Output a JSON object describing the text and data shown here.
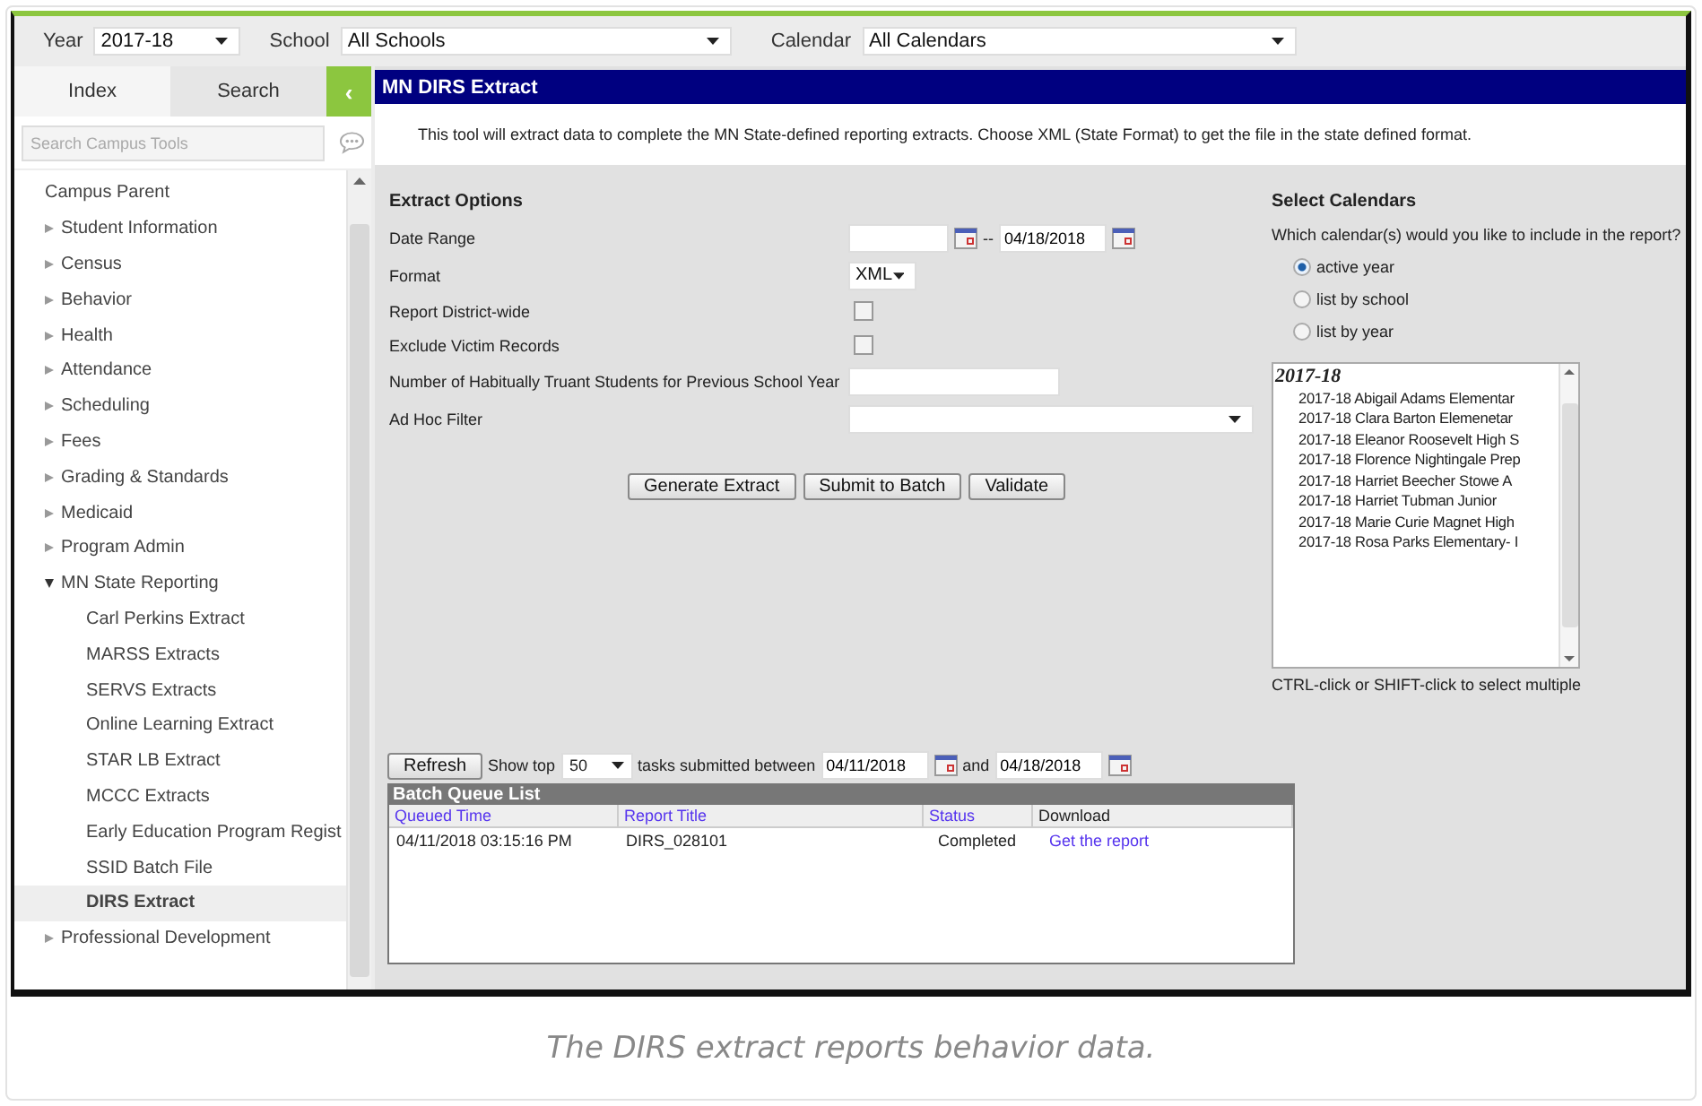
{
  "top_bar": {
    "year": {
      "label": "Year",
      "value": "2017-18"
    },
    "school": {
      "label": "School",
      "value": "All Schools"
    },
    "calendar": {
      "label": "Calendar",
      "value": "All Calendars"
    }
  },
  "sidebar": {
    "tabs": [
      {
        "label": "Index",
        "selected": true
      },
      {
        "label": "Search",
        "selected": false
      }
    ],
    "collapse_button": "‹",
    "search": {
      "placeholder": "Search Campus Tools"
    },
    "items": [
      {
        "label": "Campus Parent",
        "kind": "link"
      },
      {
        "label": "Student Information",
        "kind": "folder",
        "expanded": false
      },
      {
        "label": "Census",
        "kind": "folder",
        "expanded": false
      },
      {
        "label": "Behavior",
        "kind": "folder",
        "expanded": false
      },
      {
        "label": "Health",
        "kind": "folder",
        "expanded": false
      },
      {
        "label": "Attendance",
        "kind": "folder",
        "expanded": false
      },
      {
        "label": "Scheduling",
        "kind": "folder",
        "expanded": false
      },
      {
        "label": "Fees",
        "kind": "folder",
        "expanded": false
      },
      {
        "label": "Grading & Standards",
        "kind": "folder",
        "expanded": false
      },
      {
        "label": "Medicaid",
        "kind": "folder",
        "expanded": false
      },
      {
        "label": "Program Admin",
        "kind": "folder",
        "expanded": false
      },
      {
        "label": "MN State Reporting",
        "kind": "folder",
        "expanded": true,
        "children": [
          {
            "label": "Carl Perkins Extract",
            "selected": false
          },
          {
            "label": "MARSS Extracts",
            "selected": false
          },
          {
            "label": "SERVS Extracts",
            "selected": false
          },
          {
            "label": "Online Learning Extract",
            "selected": false
          },
          {
            "label": "STAR LB Extract",
            "selected": false
          },
          {
            "label": "MCCC Extracts",
            "selected": false
          },
          {
            "label": "Early Education Program Regist",
            "selected": false
          },
          {
            "label": "SSID Batch File",
            "selected": false
          },
          {
            "label": "DIRS Extract",
            "selected": true
          }
        ]
      },
      {
        "label": "Professional Development",
        "kind": "folder",
        "expanded": false
      }
    ]
  },
  "main": {
    "title": "MN DIRS Extract",
    "description": "This tool will extract data to complete the MN State-defined reporting extracts. Choose XML (State Format) to get the file in the state defined format.",
    "extract_options": {
      "heading": "Extract Options",
      "fields": [
        {
          "label": "Date Range",
          "kind": "daterange",
          "separator": "--",
          "end": "04/18/2018"
        },
        {
          "label": "Format",
          "kind": "select",
          "value": "XML"
        },
        {
          "label": "Report District-wide",
          "kind": "checkbox",
          "checked": false
        },
        {
          "label": "Exclude Victim Records",
          "kind": "checkbox",
          "checked": false
        },
        {
          "label": "Number of Habitually Truant Students for Previous School Year",
          "kind": "text"
        },
        {
          "label": "Ad Hoc Filter",
          "kind": "wideselect"
        }
      ],
      "buttons": [
        "Generate Extract",
        "Submit to Batch",
        "Validate"
      ]
    },
    "select_calendars": {
      "heading": "Select Calendars",
      "question": "Which calendar(s) would you like to include in the report?",
      "options": [
        {
          "label": "active year",
          "selected": true
        },
        {
          "label": "list by school",
          "selected": false
        },
        {
          "label": "list by year",
          "selected": false
        }
      ],
      "group": "2017-18",
      "calendars": [
        "2017-18 Abigail Adams Elementar",
        "2017-18 Clara Barton Elemenetar",
        "2017-18 Eleanor Roosevelt High S",
        "2017-18 Florence Nightingale Prep",
        "2017-18 Harriet Beecher Stowe A",
        "2017-18 Harriet Tubman Junior",
        "2017-18 Marie Curie Magnet High",
        "2017-18 Rosa Parks Elementary- I"
      ],
      "hint": "CTRL-click or SHIFT-click to select multiple"
    },
    "batch": {
      "refresh": "Refresh",
      "show_top": "Show top",
      "count": "50",
      "between": "tasks submitted between",
      "from": "04/11/2018",
      "and": "and",
      "to": "04/18/2018",
      "title": "Batch Queue List",
      "columns": [
        {
          "label": "Queued Time",
          "sortable": true
        },
        {
          "label": "Report Title",
          "sortable": true
        },
        {
          "label": "Status",
          "sortable": true
        },
        {
          "label": "Download",
          "sortable": false
        }
      ],
      "rows": [
        {
          "queued_time": "04/11/2018 03:15:16 PM",
          "report_title": "DIRS_028101",
          "status": "Completed",
          "download": "Get the report"
        }
      ]
    }
  },
  "caption": "The DIRS extract reports behavior data."
}
